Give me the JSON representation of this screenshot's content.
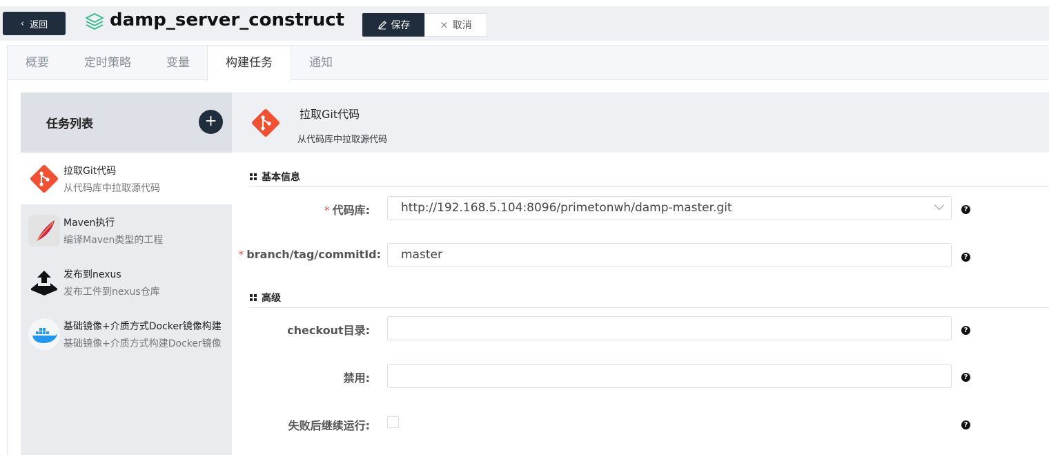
{
  "header": {
    "back_label": "返回",
    "title": "damp_server_construct",
    "save_label": "保存",
    "cancel_label": "取消"
  },
  "tabs": [
    {
      "label": "概要",
      "active": false
    },
    {
      "label": "定时策略",
      "active": false
    },
    {
      "label": "变量",
      "active": false
    },
    {
      "label": "构建任务",
      "active": true
    },
    {
      "label": "通知",
      "active": false
    }
  ],
  "task_list": {
    "title": "任务列表",
    "add_label": "+",
    "items": [
      {
        "name": "拉取Git代码",
        "desc": "从代码库中拉取源代码",
        "icon": "git-icon",
        "selected": true
      },
      {
        "name": "Maven执行",
        "desc": "编译Maven类型的工程",
        "icon": "maven-feather-icon",
        "selected": false
      },
      {
        "name": "发布到nexus",
        "desc": "发布工件到nexus仓库",
        "icon": "upload-icon",
        "selected": false
      },
      {
        "name": "基础镜像+介质方式Docker镜像构建",
        "desc": "基础镜像+介质方式构建Docker镜像",
        "icon": "docker-icon",
        "selected": false
      }
    ]
  },
  "detail": {
    "title": "拉取Git代码",
    "subtitle": "从代码库中拉取源代码",
    "sections": {
      "basic": "基本信息",
      "advanced": "高级"
    },
    "fields": {
      "repo_label": "代码库:",
      "repo_value": "http://192.168.5.104:8096/primetonwh/damp-master.git",
      "branch_label": "branch/tag/commitId:",
      "branch_value": "master",
      "checkout_label": "checkout目录:",
      "checkout_value": "",
      "disable_label": "禁用:",
      "disable_value": "",
      "continue_label": "失败后继续运行:",
      "continue_checked": false
    },
    "required_mark": "*",
    "help_mark": "?"
  },
  "colors": {
    "dark": "#1f2d3d",
    "git_orange": "#f05133",
    "accent_green": "#3dbb8a",
    "required": "#e85a4f"
  }
}
